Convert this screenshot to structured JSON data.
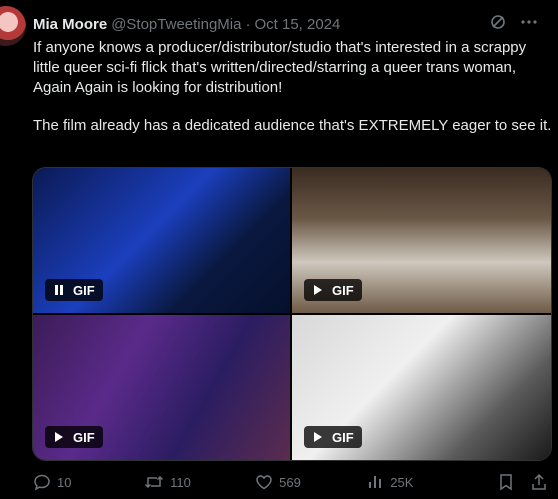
{
  "tweet": {
    "author_name": "Mia Moore",
    "author_handle": "@StopTweetingMia",
    "separator": "·",
    "date": "Oct 15, 2024",
    "paragraphs": [
      "If anyone knows a producer/distributor/studio that's interested in a scrappy little queer sci-fi flick that's written/directed/starring a queer trans woman, Again Again is looking for distribution!",
      "The film already has a dedicated audience that's EXTREMELY eager to see it."
    ]
  },
  "media": {
    "tiles": [
      {
        "label": "GIF",
        "control": "pause-icon"
      },
      {
        "label": "GIF",
        "control": "play-icon"
      },
      {
        "label": "GIF",
        "control": "play-icon"
      },
      {
        "label": "GIF",
        "control": "play-icon"
      }
    ]
  },
  "actions": {
    "replies": "10",
    "reposts": "110",
    "likes": "569",
    "views": "25K"
  },
  "colors": {
    "background": "#000000",
    "text": "#e7e9ea",
    "secondary": "#71767b",
    "border": "#2f3336"
  }
}
